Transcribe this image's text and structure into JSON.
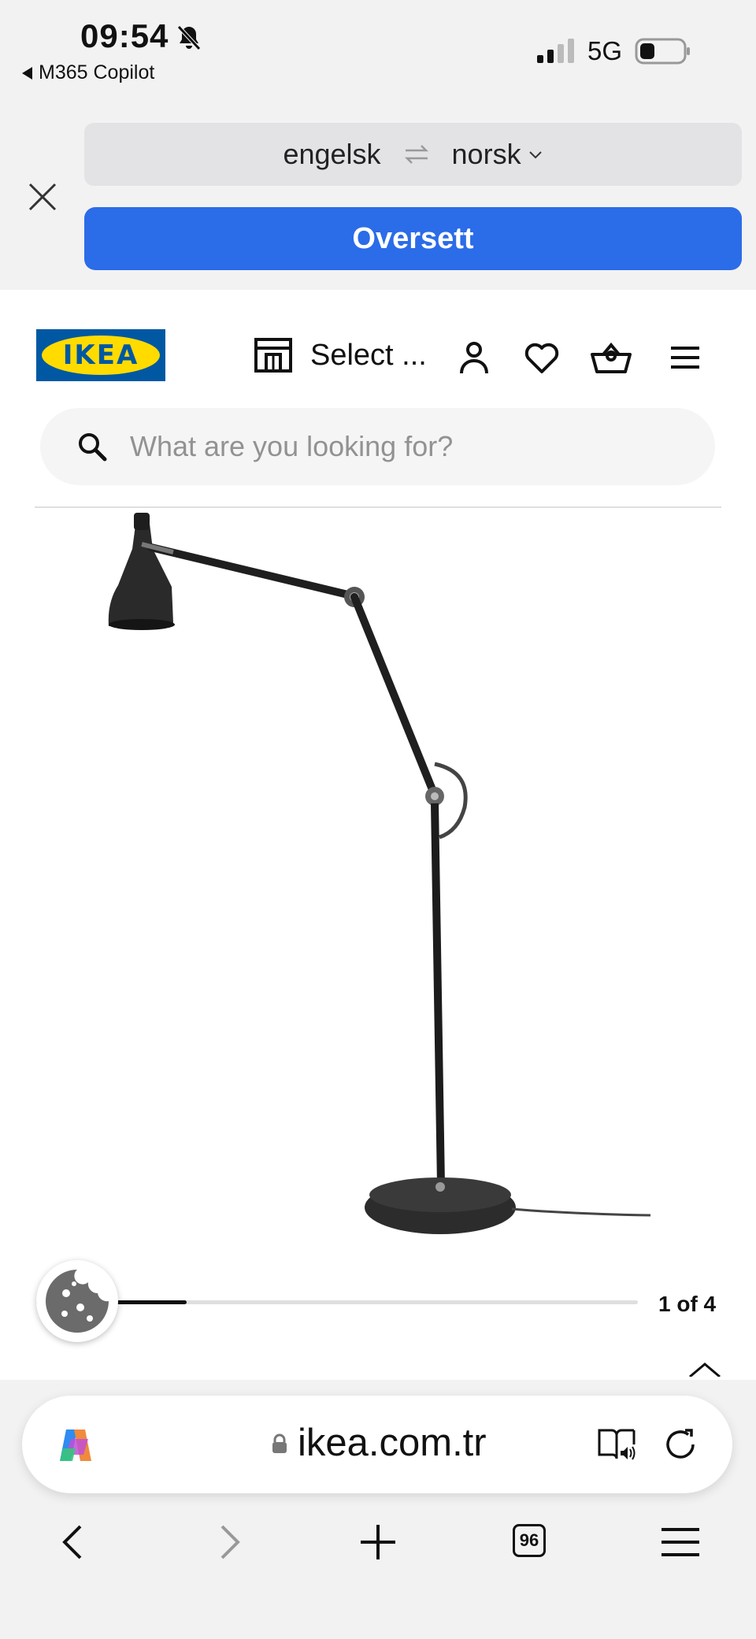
{
  "status": {
    "time": "09:54",
    "back_app": "M365 Copilot",
    "network": "5G"
  },
  "translate": {
    "source_lang": "engelsk",
    "target_lang": "norsk",
    "button": "Oversett"
  },
  "header": {
    "logo_text": "IKEA",
    "store_label": "Select ..."
  },
  "search": {
    "placeholder": "What are you looking for?"
  },
  "carousel": {
    "counter": "1 of 4",
    "current": 1,
    "total": 4
  },
  "browser": {
    "url": "ikea.com.tr",
    "tab_count": "96"
  },
  "colors": {
    "translate_button": "#2b6ce8",
    "ikea_blue": "#0058a3",
    "ikea_yellow": "#ffdb00"
  }
}
